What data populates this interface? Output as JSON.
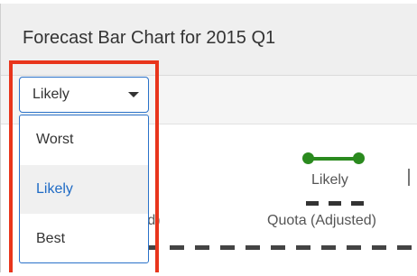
{
  "panel": {
    "title": "Forecast Bar Chart for 2015 Q1"
  },
  "scenario_select": {
    "value": "Likely",
    "options": [
      {
        "label": "Worst",
        "selected": false
      },
      {
        "label": "Likely",
        "selected": true
      },
      {
        "label": "Best",
        "selected": false
      }
    ]
  },
  "legend": {
    "likely_label": "Likely",
    "quota_label": "Quota (Adjusted)",
    "partial_label": "ted)"
  },
  "colors": {
    "likely_series": "#2a8a1e",
    "highlight_border": "#e8351c",
    "focus_border": "#2a72c9",
    "selected_option_text": "#1f6bc5"
  }
}
